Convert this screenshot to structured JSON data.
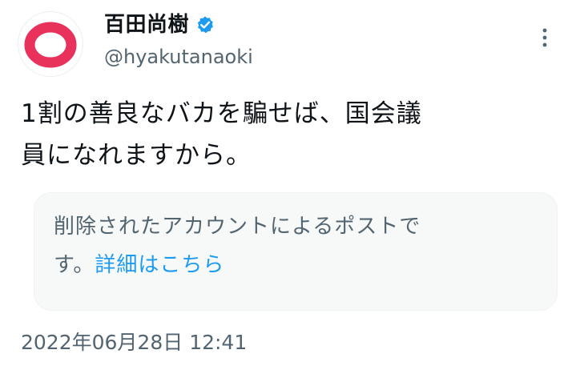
{
  "author": {
    "display_name": "百田尚樹",
    "handle": "@hyakutanaoki",
    "verified_icon": "verified-badge-icon",
    "avatar_ring_color": "#e8315b",
    "verified_color": "#1d9bf0"
  },
  "tweet": {
    "text_line1": "1割の善良なバカを騙せば、国会議",
    "text_line2": "員になれますから。"
  },
  "quoted_notice": {
    "line1": "削除されたアカウントによるポストで",
    "line2_prefix": "す。",
    "link_label": "詳細はこちら"
  },
  "timestamp": "2022年06月28日 12:41",
  "menu": {
    "icon": "more-vertical-icon"
  }
}
